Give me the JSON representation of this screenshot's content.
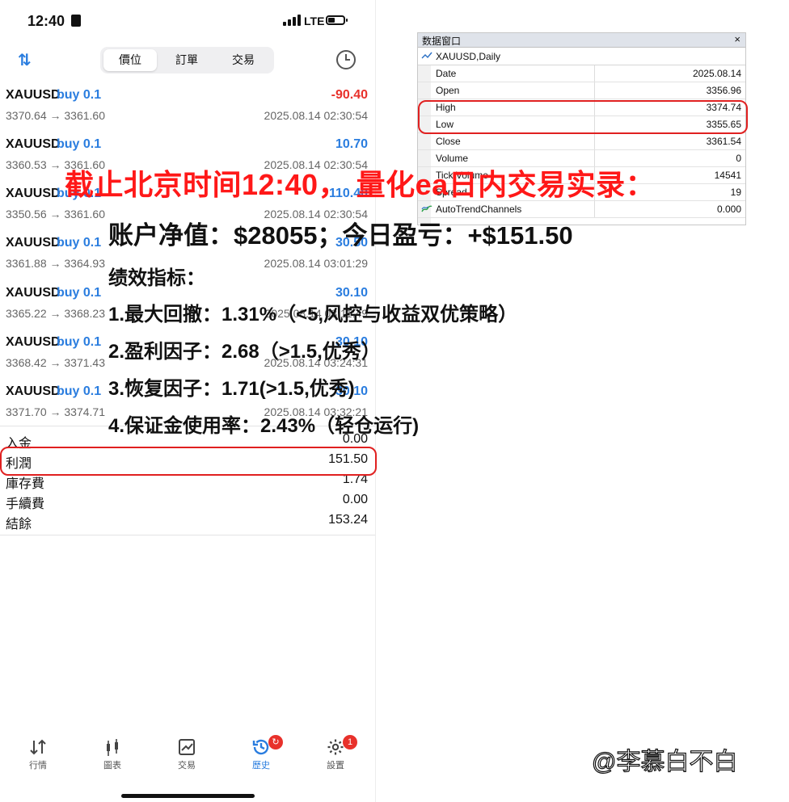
{
  "status_bar": {
    "time": "12:40",
    "network": "LTE"
  },
  "segmented_control": {
    "tabs": [
      "價位",
      "訂單",
      "交易"
    ],
    "active_index": 0
  },
  "trades": [
    {
      "symbol": "XAUUSD",
      "direction": "buy 0.1",
      "profit": "-90.40",
      "prices": "3370.64 → 3361.60",
      "time": "2025.08.14 02:30:54"
    },
    {
      "symbol": "XAUUSD",
      "direction": "buy 0.1",
      "profit": "10.70",
      "prices": "3360.53 → 3361.60",
      "time": "2025.08.14 02:30:54"
    },
    {
      "symbol": "XAUUSD",
      "direction": "buy 0.1",
      "profit": "110.40",
      "prices": "3350.56 → 3361.60",
      "time": "2025.08.14 02:30:54"
    },
    {
      "symbol": "XAUUSD",
      "direction": "buy 0.1",
      "profit": "30.50",
      "prices": "3361.88 → 3364.93",
      "time": "2025.08.14 03:01:29"
    },
    {
      "symbol": "XAUUSD",
      "direction": "buy 0.1",
      "profit": "30.10",
      "prices": "3365.22 → 3368.23",
      "time": "2025.08.14 03:11:49"
    },
    {
      "symbol": "XAUUSD",
      "direction": "buy 0.1",
      "profit": "30.10",
      "prices": "3368.42 → 3371.43",
      "time": "2025.08.14 03:24:31"
    },
    {
      "symbol": "XAUUSD",
      "direction": "buy 0.1",
      "profit": "30.10",
      "prices": "3371.70 → 3374.71",
      "time": "2025.08.14 03:32:21"
    }
  ],
  "summary": [
    {
      "label": "入金",
      "value": "0.00"
    },
    {
      "label": "利潤",
      "value": "151.50"
    },
    {
      "label": "庫存費",
      "value": "1.74"
    },
    {
      "label": "手續費",
      "value": "0.00"
    },
    {
      "label": "結餘",
      "value": "153.24"
    }
  ],
  "bottom_tabs": [
    {
      "label": "行情",
      "icon": "quotes-arrows-icon"
    },
    {
      "label": "圖表",
      "icon": "candlestick-chart-icon"
    },
    {
      "label": "交易",
      "icon": "trade-chart-icon"
    },
    {
      "label": "歷史",
      "icon": "history-icon",
      "badge": ""
    },
    {
      "label": "設置",
      "icon": "settings-gear-icon",
      "badge": "1"
    }
  ],
  "data_window": {
    "title": "数据窗口",
    "close": "×",
    "symbol": "XAUUSD,Daily",
    "rows": [
      {
        "key": "Date",
        "value": "2025.08.14"
      },
      {
        "key": "Open",
        "value": "3356.96"
      },
      {
        "key": "High",
        "value": "3374.74"
      },
      {
        "key": "Low",
        "value": "3355.65"
      },
      {
        "key": "Close",
        "value": "3361.54"
      },
      {
        "key": "Volume",
        "value": "0"
      },
      {
        "key": "Tick Volume",
        "value": "14541"
      },
      {
        "key": "Spread",
        "value": "19"
      },
      {
        "key": "AutoTrendChannels",
        "value": "0.000"
      }
    ]
  },
  "overlay": {
    "headline": "截止北京时间12:40， 量化ea日内交易实录：",
    "equity_line": "账户净值：$28055；今日盈亏：+$151.50",
    "metrics_title": "绩效指标：",
    "metrics": [
      "1.最大回撤：1.31%（<5,风控与收益双优策略）",
      "2.盈利因子：2.68（>1.5,优秀）",
      "3.恢复因子：1.71(>1.5,优秀)",
      "4.保证金使用率：2.43%（轻仓运行)"
    ]
  },
  "watermark": "@李慕白不白",
  "colors": {
    "accent_blue": "#2a7ddf",
    "loss_red": "#e8312b",
    "highlight_red": "#e02020",
    "headline_red": "#ff1818"
  }
}
